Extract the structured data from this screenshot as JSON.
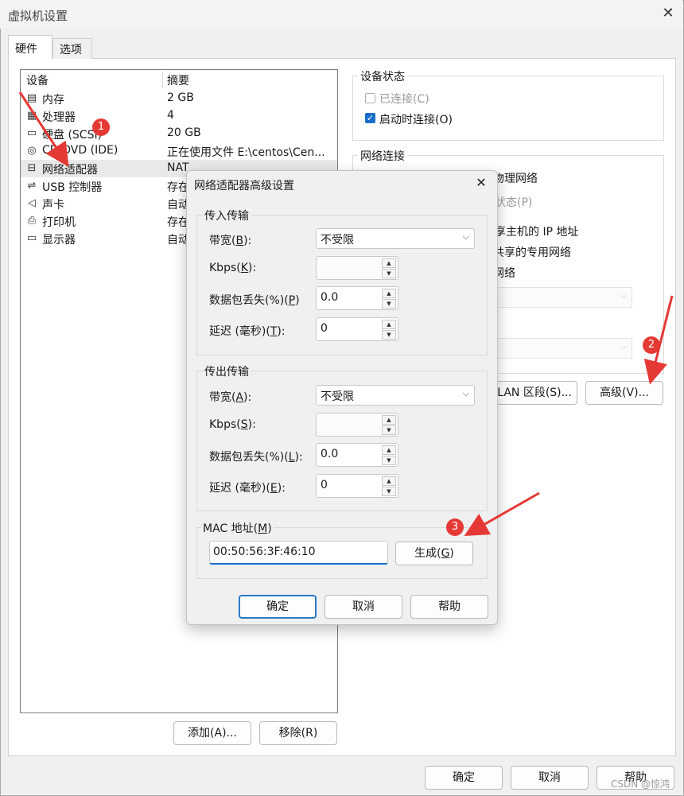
{
  "window": {
    "title": "虚拟机设置",
    "close": "✕"
  },
  "tabs": [
    "硬件",
    "选项"
  ],
  "device_list": {
    "headers": {
      "device": "设备",
      "summary": "摘要"
    },
    "rows": [
      {
        "icon": "memory-icon",
        "glyph": "▤",
        "name": "内存",
        "summary": "2 GB"
      },
      {
        "icon": "cpu-icon",
        "glyph": "▦",
        "name": "处理器",
        "summary": "4"
      },
      {
        "icon": "disk-icon",
        "glyph": "▭",
        "name": "硬盘 (SCSI)",
        "summary": "20 GB"
      },
      {
        "icon": "cd-icon",
        "glyph": "◎",
        "name": "CD/DVD (IDE)",
        "summary": "正在使用文件 E:\\centos\\Cen..."
      },
      {
        "icon": "network-icon",
        "glyph": "⊟",
        "name": "网络适配器",
        "summary": "NAT"
      },
      {
        "icon": "usb-icon",
        "glyph": "⇌",
        "name": "USB 控制器",
        "summary": "存在"
      },
      {
        "icon": "speaker-icon",
        "glyph": "◁",
        "name": "声卡",
        "summary": "自动"
      },
      {
        "icon": "printer-icon",
        "glyph": "⎙",
        "name": "打印机",
        "summary": "存在"
      },
      {
        "icon": "monitor-icon",
        "glyph": "▭",
        "name": "显示器",
        "summary": "自动"
      }
    ],
    "add_button": "添加(A)...",
    "remove_button": "移除(R)"
  },
  "device_status": {
    "legend": "设备状态",
    "connected": "已连接(C)",
    "connect_at_power_on": "启动时连接(O)"
  },
  "network_connection": {
    "legend": "网络连接",
    "partial_lines": [
      "物理网络",
      "状态(P)",
      "享主机的 IP 地址",
      "共享的专用网络",
      "网络"
    ],
    "lan_segments_button": "LAN 区段(S)...",
    "advanced_button": "高级(V)..."
  },
  "footer": {
    "ok": "确定",
    "cancel": "取消",
    "help": "帮助"
  },
  "dialog": {
    "title": "网络适配器高级设置",
    "close": "✕",
    "incoming": {
      "legend": "传入传输",
      "bandwidth_label": [
        "带宽(",
        "B",
        "):"
      ],
      "bandwidth_value": "不受限",
      "kbps_label": [
        "Kbps(",
        "K",
        "):"
      ],
      "kbps_value": "",
      "loss_label": [
        "数据包丢失(%)(",
        "P",
        ")"
      ],
      "loss_value": "0.0",
      "delay_label": [
        "延迟 (毫秒)(",
        "T",
        "):"
      ],
      "delay_value": "0"
    },
    "outgoing": {
      "legend": "传出传输",
      "bandwidth_label": [
        "带宽(",
        "A",
        "):"
      ],
      "bandwidth_value": "不受限",
      "kbps_label": [
        "Kbps(",
        "S",
        "):"
      ],
      "kbps_value": "",
      "loss_label": [
        "数据包丢失(%)(",
        "L",
        "):"
      ],
      "loss_value": "0.0",
      "delay_label": [
        "延迟 (毫秒)(",
        "E",
        "):"
      ],
      "delay_value": "0"
    },
    "mac": {
      "legend_pre": "MAC 地址(",
      "legend_key": "M",
      "legend_post": ")",
      "value": "00:50:56:3F:46:10",
      "generate_pre": "生成(",
      "generate_key": "G",
      "generate_post": ")"
    },
    "ok": "确定",
    "cancel": "取消",
    "help": "帮助"
  },
  "annotations": {
    "badges": [
      "1",
      "2",
      "3"
    ],
    "arrow_color": "#e53935"
  },
  "watermark": "CSDN @惊鸿"
}
